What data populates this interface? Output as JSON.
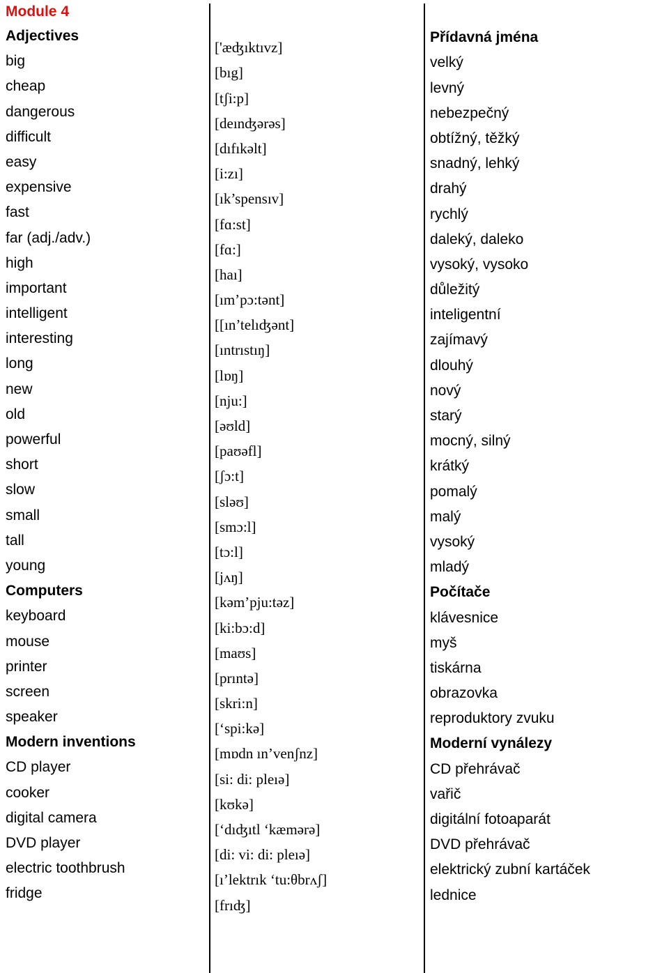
{
  "document": {
    "module_title": "Module 4",
    "module_title_color": "#e10e0e",
    "columns": {
      "english_header": "Adjectives",
      "phonetic_header": "['æʤıktıvz]",
      "czech_header": "Přídavná jména"
    }
  },
  "entries": [
    {
      "english": "big",
      "phonetic": "[bıg]",
      "czech": "velký",
      "heading": false
    },
    {
      "english": "cheap",
      "phonetic": "[tʃi:p]",
      "czech": "levný",
      "heading": false
    },
    {
      "english": "dangerous",
      "phonetic": "[deınʤərəs]",
      "czech": "nebezpečný",
      "heading": false
    },
    {
      "english": "difficult",
      "phonetic": "[dıfıkəlt]",
      "czech": "obtížný, těžký",
      "heading": false
    },
    {
      "english": "easy",
      "phonetic": "[i:zı]",
      "czech": "snadný, lehký",
      "heading": false
    },
    {
      "english": "expensive",
      "phonetic": "[ık’spensıv]",
      "czech": "drahý",
      "heading": false
    },
    {
      "english": "fast",
      "phonetic": "[fɑ:st]",
      "czech": "rychlý",
      "heading": false
    },
    {
      "english": "far (adj./adv.)",
      "phonetic": "[fɑ:]",
      "czech": "daleký, daleko",
      "heading": false
    },
    {
      "english": "high",
      "phonetic": "[haı]",
      "czech": "vysoký, vysoko",
      "heading": false
    },
    {
      "english": "important",
      "phonetic": "[ım’pɔ:tənt]",
      "czech": "důležitý",
      "heading": false
    },
    {
      "english": "intelligent",
      "phonetic": "[[ın’telıʤənt]",
      "czech": "inteligentní",
      "heading": false
    },
    {
      "english": "interesting",
      "phonetic": "[ıntrıstıŋ]",
      "czech": "zajímavý",
      "heading": false
    },
    {
      "english": "long",
      "phonetic": "[lɒŋ]",
      "czech": "dlouhý",
      "heading": false
    },
    {
      "english": "new",
      "phonetic": "[nju:]",
      "czech": "nový",
      "heading": false
    },
    {
      "english": "old",
      "phonetic": "[əʊld]",
      "czech": "starý",
      "heading": false
    },
    {
      "english": "powerful",
      "phonetic": "[paʊəfl]",
      "czech": "mocný, silný",
      "heading": false
    },
    {
      "english": "short",
      "phonetic": "[ʃɔ:t]",
      "czech": "krátký",
      "heading": false
    },
    {
      "english": "slow",
      "phonetic": "[sləʊ]",
      "czech": "pomalý",
      "heading": false
    },
    {
      "english": "small",
      "phonetic": "[smɔ:l]",
      "czech": "malý",
      "heading": false
    },
    {
      "english": "tall",
      "phonetic": "[tɔ:l]",
      "czech": "vysoký",
      "heading": false
    },
    {
      "english": "young",
      "phonetic": "[jʌŋ]",
      "czech": "mladý",
      "heading": false
    },
    {
      "english": "Computers",
      "phonetic": "[kəm’pju:təz]",
      "czech": "Počítače",
      "heading": true
    },
    {
      "english": "keyboard",
      "phonetic": "[ki:bɔ:d]",
      "czech": "klávesnice",
      "heading": false
    },
    {
      "english": "mouse",
      "phonetic": "[maʊs]",
      "czech": "myš",
      "heading": false
    },
    {
      "english": "printer",
      "phonetic": "[prıntə]",
      "czech": "tiskárna",
      "heading": false
    },
    {
      "english": "screen",
      "phonetic": "[skri:n]",
      "czech": "obrazovka",
      "heading": false
    },
    {
      "english": "speaker",
      "phonetic": "[‘spi:kə]",
      "czech": "reproduktory zvuku",
      "heading": false
    },
    {
      "english": "Modern inventions",
      "phonetic": "[mɒdn  ın’venʃnz]",
      "czech": "Moderní vynálezy",
      "heading": true
    },
    {
      "english": "CD player",
      "phonetic": "[si:  di:  pleıə]",
      "czech": "CD přehrávač",
      "heading": false
    },
    {
      "english": "cooker",
      "phonetic": "[kʊkə]",
      "czech": "vařič",
      "heading": false
    },
    {
      "english": "digital camera",
      "phonetic": "[‘dıʤıtl  ‘kæmərə]",
      "czech": "digitální fotoaparát",
      "heading": false
    },
    {
      "english": "DVD player",
      "phonetic": "[di:  vi:  di:  pleıə]",
      "czech": "DVD přehrávač",
      "heading": false
    },
    {
      "english": "electric toothbrush",
      "phonetic": "[ı’lektrık  ‘tu:θbrʌʃ]",
      "czech": "elektrický zubní kartáček",
      "heading": false
    },
    {
      "english": "fridge",
      "phonetic": "[frıʤ]",
      "czech": "lednice",
      "heading": false
    }
  ]
}
